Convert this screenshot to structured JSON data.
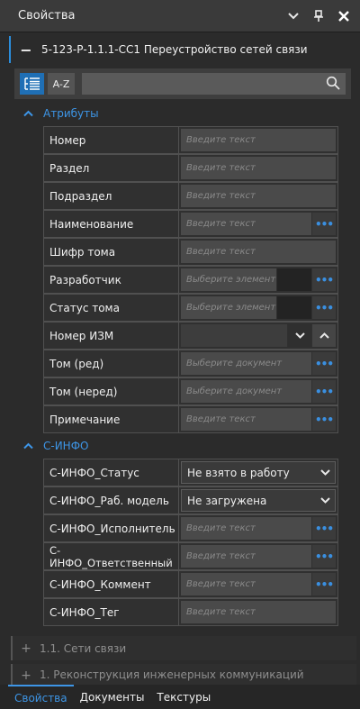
{
  "window": {
    "title": "Свойства"
  },
  "document": {
    "title": "5-123-Р-1.1.1-СС1 Переустройство сетей связи"
  },
  "toolbar": {
    "sort_label": "A-Z",
    "search_value": ""
  },
  "sections": {
    "attributes": {
      "name": "Атрибуты",
      "props": {
        "nomer": {
          "label": "Номер",
          "placeholder": "Введите текст"
        },
        "razdel": {
          "label": "Раздел",
          "placeholder": "Введите текст"
        },
        "podrazdel": {
          "label": "Подраздел",
          "placeholder": "Введите текст"
        },
        "naimenovanie": {
          "label": "Наименование",
          "placeholder": "Введите текст"
        },
        "shifr": {
          "label": "Шифр тома",
          "placeholder": "Введите текст"
        },
        "razrabotchik": {
          "label": "Разработчик",
          "placeholder": "Выберите элемент"
        },
        "status": {
          "label": "Статус тома",
          "placeholder": "Выберите элемент"
        },
        "nomer_izm": {
          "label": "Номер ИЗМ",
          "value": ""
        },
        "tom_red": {
          "label": "Том (ред)",
          "placeholder": "Выберите документ"
        },
        "tom_nered": {
          "label": "Том (неред)",
          "placeholder": "Выберите документ"
        },
        "primechanie": {
          "label": "Примечание",
          "placeholder": "Введите текст"
        }
      }
    },
    "cinfo": {
      "name": "С-ИНФО",
      "props": {
        "status": {
          "label": "С-ИНФО_Статус",
          "value": "Не взято в работу"
        },
        "model": {
          "label": "С-ИНФО_Раб. модель",
          "value": "Не загружена"
        },
        "ispolnitel": {
          "label": "С-ИНФО_Исполнитель",
          "placeholder": "Введите текст"
        },
        "otvetstvenny": {
          "label": "С-ИНФО_Ответственный",
          "placeholder": "Введите текст"
        },
        "komment": {
          "label": "С-ИНФО_Коммент",
          "placeholder": "Введите текст"
        },
        "teg": {
          "label": "С-ИНФО_Тег",
          "placeholder": "Введите текст"
        }
      }
    }
  },
  "lower_items": [
    {
      "label": "1.1. Сети связи"
    },
    {
      "label": "1. Реконструкция инженерных коммуникаций"
    }
  ],
  "tabs": [
    {
      "label": "Свойства",
      "active": true
    },
    {
      "label": "Документы",
      "active": false
    },
    {
      "label": "Текстуры",
      "active": false
    }
  ],
  "colors": {
    "accent": "#3d95e6",
    "background": "#2b2b2b",
    "field": "#4a4a4a"
  }
}
